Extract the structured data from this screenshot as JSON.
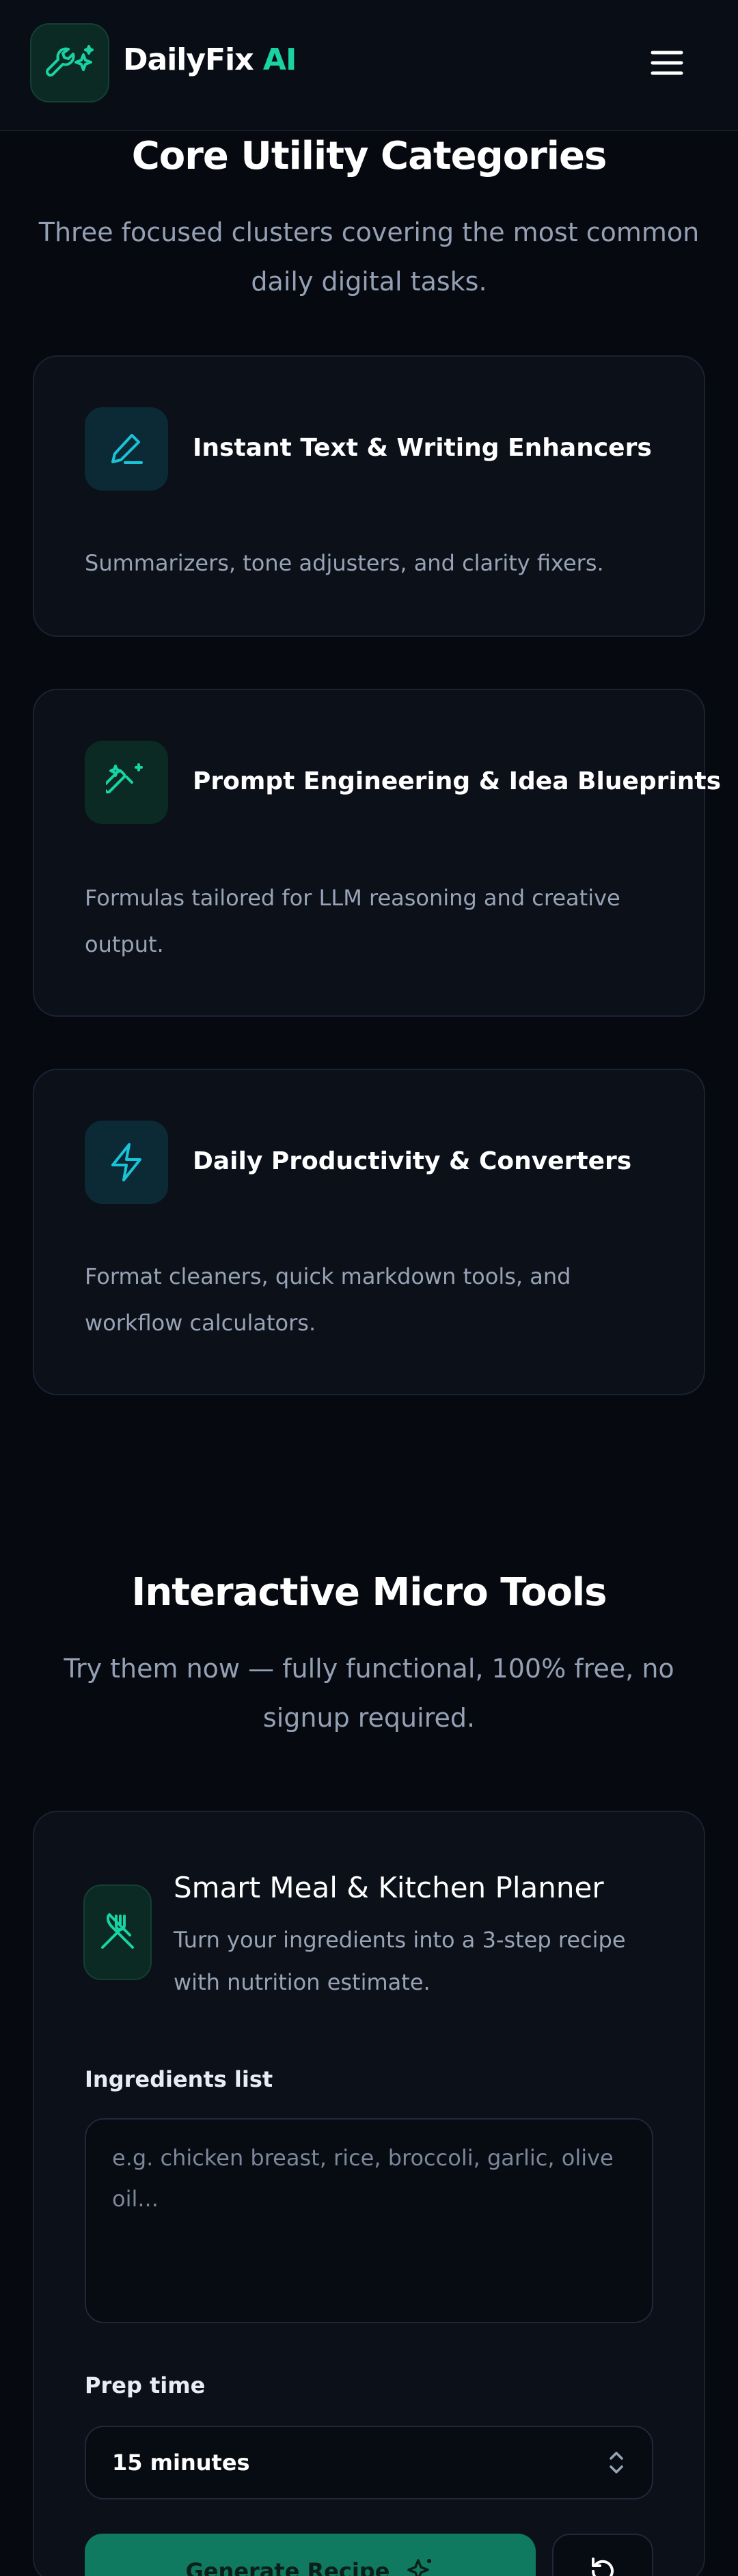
{
  "header": {
    "brand_name": "DailyFix",
    "brand_suffix": "AI",
    "logo_icon": "wrench-sparkles-icon",
    "menu_icon": "hamburger-menu-icon"
  },
  "categories_section": {
    "title": "Core Utility Categories",
    "subtitle": "Three focused clusters covering the most common daily digital tasks.",
    "cards": [
      {
        "icon": "pen-icon",
        "title": "Instant Text & Writing Enhancers",
        "description": "Summarizers, tone adjusters, and clarity fixers.",
        "accent": "#19c4d8"
      },
      {
        "icon": "magic-wand-icon",
        "title": "Prompt Engineering & Idea Blueprints",
        "description": "Formulas tailored for LLM reasoning and creative output.",
        "accent": "#19d3a2"
      },
      {
        "icon": "lightning-bolt-icon",
        "title": "Daily Productivity & Converters",
        "description": "Format cleaners, quick markdown tools, and workflow calculators.",
        "accent": "#19c4d8"
      }
    ]
  },
  "tools_section": {
    "title": "Interactive Micro Tools",
    "subtitle": "Try them now — fully functional, 100% free, no signup required.",
    "tool": {
      "icon": "fork-knife-icon",
      "title": "Smart Meal & Kitchen Planner",
      "description": "Turn your ingredients into a 3-step recipe with nutrition estimate.",
      "ingredients_label": "Ingredients list",
      "ingredients_placeholder": "e.g. chicken breast, rice, broccoli, garlic, olive oil...",
      "prep_label": "Prep time",
      "prep_value": "15 minutes",
      "generate_label": "Generate Recipe",
      "reset_icon": "reset-icon"
    }
  },
  "colors": {
    "accent_green": "#19d3a2",
    "accent_cyan": "#19c4d8",
    "background": "#060910",
    "card": "#0b1019"
  }
}
